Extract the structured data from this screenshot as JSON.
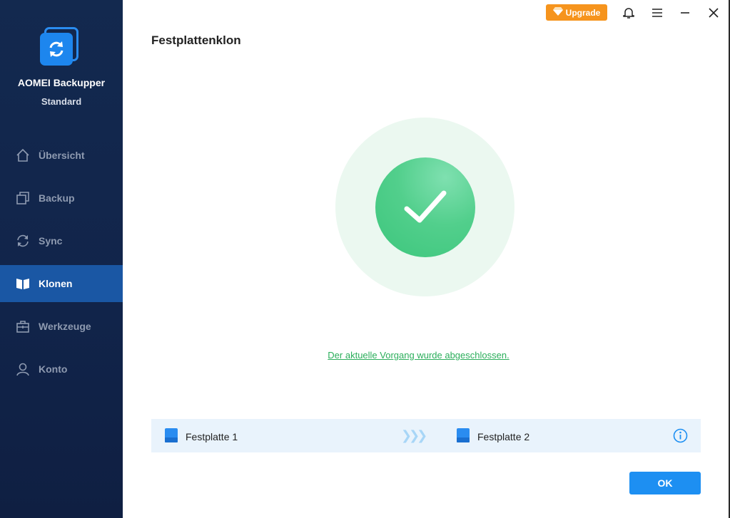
{
  "app": {
    "name": "AOMEI Backupper",
    "edition": "Standard"
  },
  "sidebar": {
    "items": [
      {
        "label": "Übersicht",
        "icon": "home-icon",
        "active": false
      },
      {
        "label": "Backup",
        "icon": "backup-icon",
        "active": false
      },
      {
        "label": "Sync",
        "icon": "sync-icon",
        "active": false
      },
      {
        "label": "Klonen",
        "icon": "clone-icon",
        "active": true
      },
      {
        "label": "Werkzeuge",
        "icon": "toolbox-icon",
        "active": false
      },
      {
        "label": "Konto",
        "icon": "user-icon",
        "active": false
      }
    ]
  },
  "topbar": {
    "upgrade_label": "Upgrade"
  },
  "main": {
    "title": "Festplattenklon",
    "status_message": "Der aktuelle Vorgang wurde abgeschlossen.",
    "source_disk": "Festplatte 1",
    "target_disk": "Festplatte 2",
    "ok_label": "OK"
  },
  "colors": {
    "sidebar_bg": "#13294f",
    "active_item": "#1a57a4",
    "accent": "#1d8ff2",
    "upgrade": "#f6941d",
    "success": "#3cc67c"
  }
}
